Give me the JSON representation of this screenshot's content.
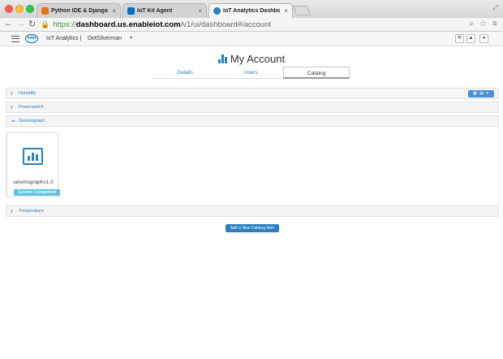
{
  "browser": {
    "tabs": [
      {
        "label": "Python IDE & Django IDE f",
        "favicon_color": "#e2731b"
      },
      {
        "label": "IoT Kit Agent",
        "favicon_color": "#0071c5"
      },
      {
        "label": "IoT Analytics Dashboard",
        "favicon_color": "#2a7fc1"
      }
    ],
    "url": {
      "scheme": "https://",
      "host": "dashboard.us.enableiot.com",
      "path": "/v1/ui/dashboard#/account"
    }
  },
  "app_header": {
    "logo": "intel",
    "title": "IoT Analytics |",
    "user": "DotSilverman",
    "caret": "▾"
  },
  "page": {
    "title": "My Account",
    "tabs": [
      "Details",
      "Users",
      "Catalog"
    ],
    "active_tab": "Catalog"
  },
  "catalog": {
    "sections": [
      {
        "label": "Humidity",
        "expanded": false
      },
      {
        "label": "Powerswitch",
        "expanded": false
      },
      {
        "label": "Seismograph",
        "expanded": true
      },
      {
        "label": "Temperature",
        "expanded": false
      }
    ],
    "components": [
      {
        "name": "seismographv1.0",
        "badge": "Custom Component"
      }
    ],
    "add_button": "Add a New Catalog Item"
  },
  "colors": {
    "accent": "#2a7fc1",
    "badge": "#5bc0de",
    "secure": "#3a9d3a"
  }
}
